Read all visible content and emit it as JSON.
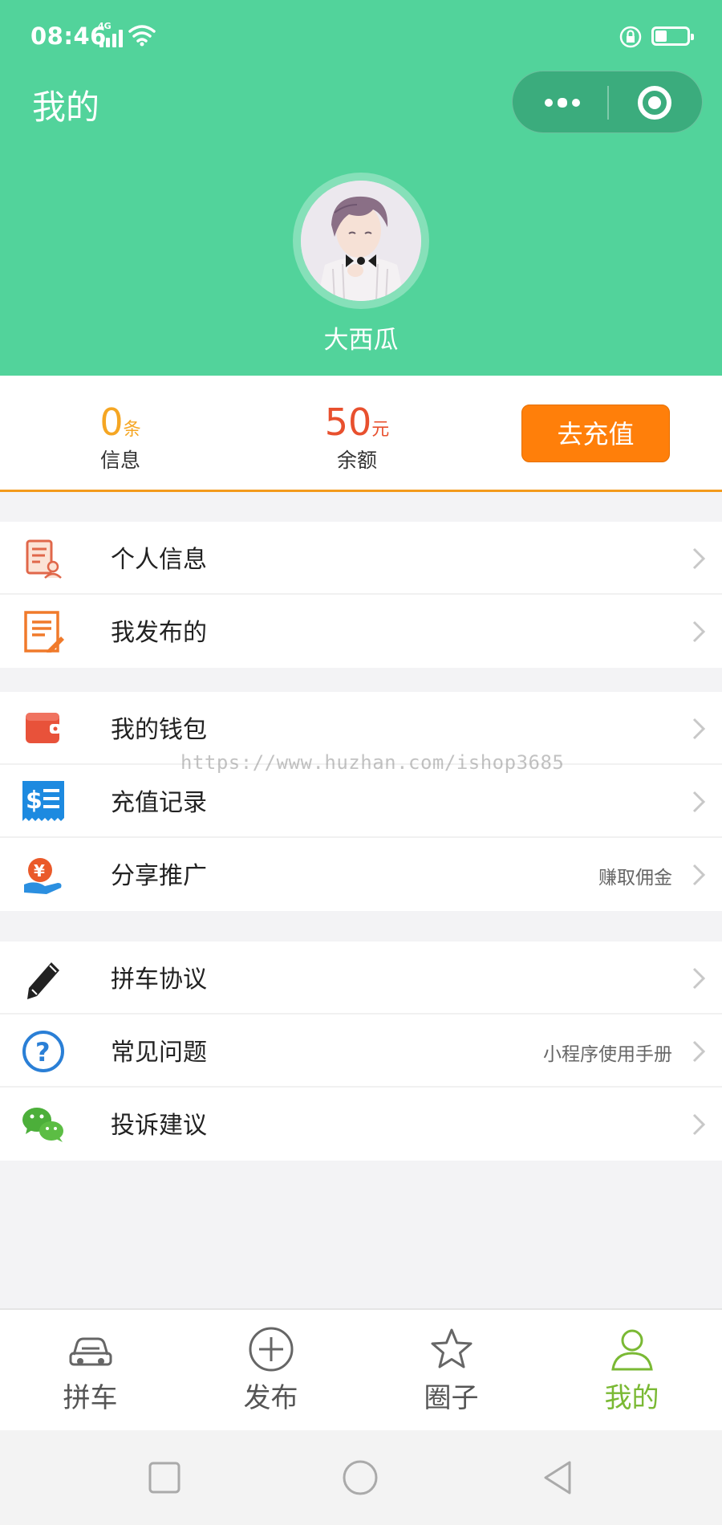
{
  "status_bar": {
    "time": "08:46",
    "network": "4G"
  },
  "header": {
    "title": "我的",
    "bg_color": "#52d39b"
  },
  "profile": {
    "username": "大西瓜"
  },
  "stats": {
    "messages": {
      "value": "0",
      "unit": "条",
      "label": "信息"
    },
    "balance": {
      "value": "50",
      "unit": "元",
      "label": "余额"
    },
    "recharge_label": "去充值"
  },
  "menu": {
    "group1": [
      {
        "label": "个人信息",
        "icon": "profile-card-icon"
      },
      {
        "label": "我发布的",
        "icon": "document-edit-icon"
      }
    ],
    "group2": [
      {
        "label": "我的钱包",
        "icon": "wallet-icon"
      },
      {
        "label": "充值记录",
        "icon": "receipt-icon"
      },
      {
        "label": "分享推广",
        "icon": "yuan-hand-icon",
        "sub": "赚取佣金"
      }
    ],
    "group3": [
      {
        "label": "拼车协议",
        "icon": "pencil-icon"
      },
      {
        "label": "常见问题",
        "icon": "question-icon",
        "sub": "小程序使用手册"
      },
      {
        "label": "投诉建议",
        "icon": "wechat-icon"
      }
    ]
  },
  "watermark": "https://www.huzhan.com/ishop3685",
  "tabbar": [
    {
      "label": "拼车",
      "icon": "car-icon",
      "active": false
    },
    {
      "label": "发布",
      "icon": "plus-circle-icon",
      "active": false
    },
    {
      "label": "圈子",
      "icon": "star-icon",
      "active": false
    },
    {
      "label": "我的",
      "icon": "user-icon",
      "active": true
    }
  ],
  "colors": {
    "accent_green": "#52d39b",
    "orange": "#ff7f0a",
    "active_tab": "#7ab934"
  }
}
